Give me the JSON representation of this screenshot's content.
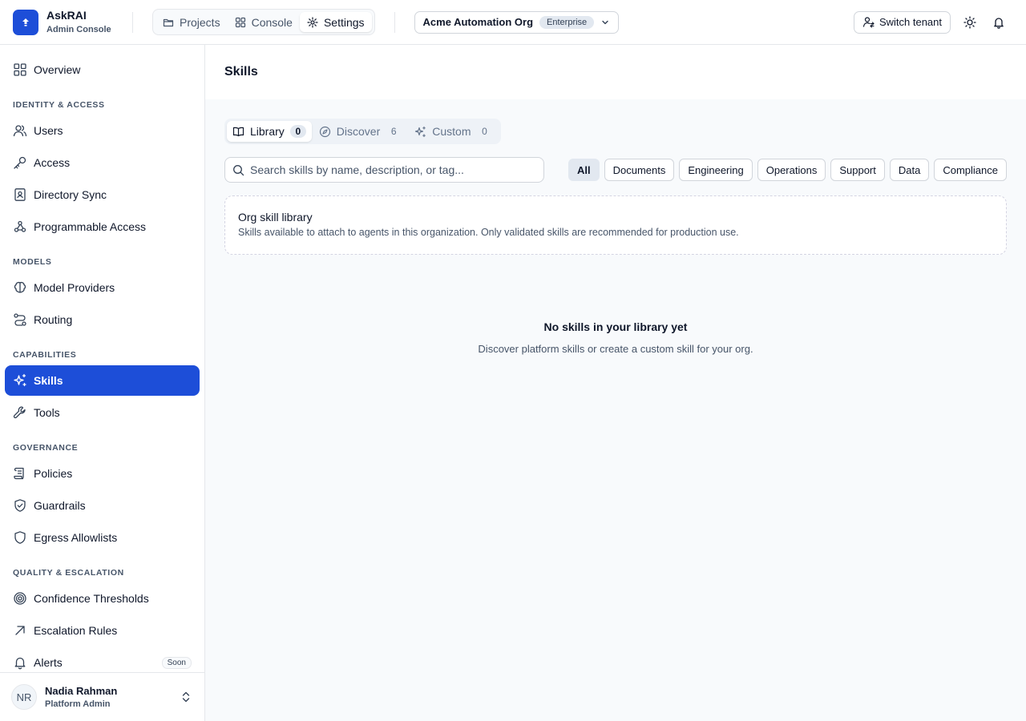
{
  "brand": {
    "name": "AskRAI",
    "subtitle": "Admin Console",
    "accent": "#1d4ed8"
  },
  "top_tabs": [
    {
      "label": "Projects",
      "icon": "folder-icon"
    },
    {
      "label": "Console",
      "icon": "grid-icon"
    },
    {
      "label": "Settings",
      "icon": "gear-icon",
      "active": true
    }
  ],
  "org": {
    "name": "Acme Automation Org",
    "plan": "Enterprise"
  },
  "header_actions": {
    "switch_tenant": "Switch tenant",
    "theme_icon": "sun-icon",
    "notifications_icon": "bell-icon"
  },
  "sidebar": {
    "overview": "Overview",
    "sections": {
      "identity": "IDENTITY & ACCESS",
      "models": "MODELS",
      "capabilities": "CAPABILITIES",
      "governance": "GOVERNANCE",
      "quality": "QUALITY & ESCALATION"
    },
    "items": {
      "users": "Users",
      "access": "Access",
      "directory_sync": "Directory Sync",
      "programmable_access": "Programmable Access",
      "model_providers": "Model Providers",
      "routing": "Routing",
      "skills": "Skills",
      "tools": "Tools",
      "policies": "Policies",
      "guardrails": "Guardrails",
      "egress_allowlists": "Egress Allowlists",
      "confidence_thresholds": "Confidence Thresholds",
      "escalation_rules": "Escalation Rules",
      "alerts": "Alerts"
    },
    "alerts_badge": "Soon",
    "active": "skills"
  },
  "user": {
    "initials": "NR",
    "name": "Nadia Rahman",
    "role": "Platform Admin"
  },
  "main": {
    "title": "Skills",
    "segments": [
      {
        "label": "Library",
        "count": "0",
        "active": true
      },
      {
        "label": "Discover",
        "count": "6"
      },
      {
        "label": "Custom",
        "count": "0"
      }
    ],
    "search_placeholder": "Search skills by name, description, or tag...",
    "filters": [
      "All",
      "Documents",
      "Engineering",
      "Operations",
      "Support",
      "Data",
      "Compliance"
    ],
    "active_filter": "All",
    "library_card": {
      "title": "Org skill library",
      "description": "Skills available to attach to agents in this organization. Only validated skills are recommended for production use."
    },
    "empty_state": {
      "title": "No skills in your library yet",
      "description": "Discover platform skills or create a custom skill for your org."
    }
  }
}
